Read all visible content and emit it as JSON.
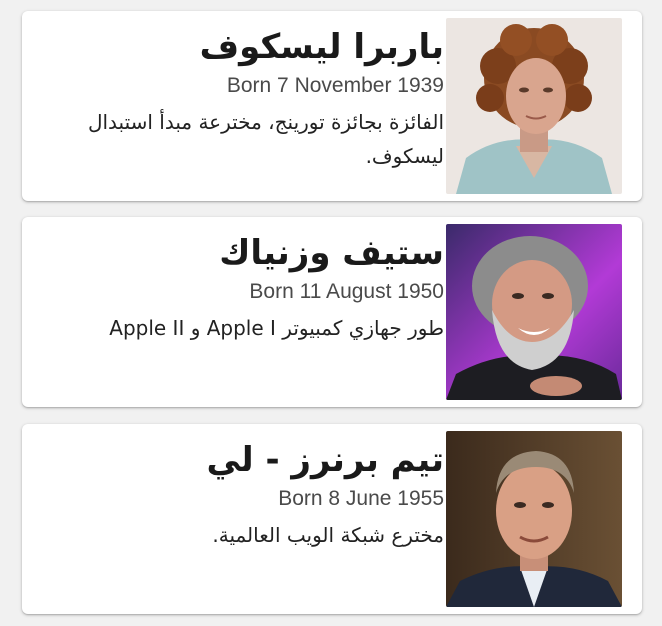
{
  "cards": [
    {
      "name": "باربرا ليسكوف",
      "born": "Born 7 November 1939",
      "description": "الفائزة بجائزة تورينج، مخترعة مبدأ استبدال ليسكوف."
    },
    {
      "name": "ستيف وزنياك",
      "born": "Born 11 August 1950",
      "description": "طور جهازي كمبيوتر Apple I و Apple II"
    },
    {
      "name": "تيم برنرز - لي",
      "born": "Born 8 June 1955",
      "description": "مخترع شبكة الويب العالمية."
    }
  ]
}
